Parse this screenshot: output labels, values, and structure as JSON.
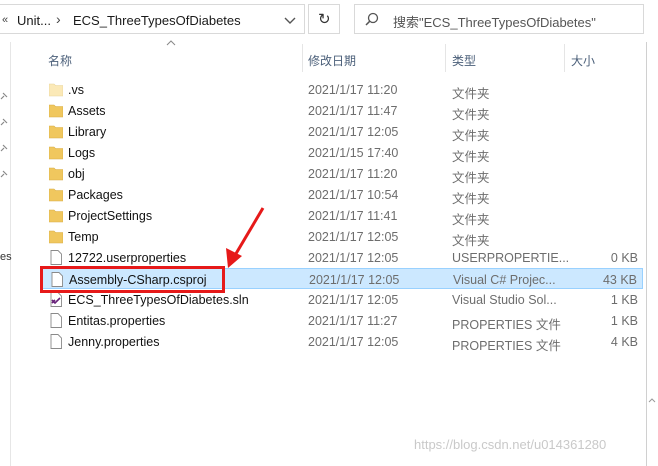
{
  "address": {
    "back_glyph": "«",
    "crumb_parent": "Unit...",
    "crumb_sep": "›",
    "crumb_current": "ECS_ThreeTypesOfDiabetes",
    "search_placeholder": "搜索\"ECS_ThreeTypesOfDiabetes\""
  },
  "nav": {
    "cut_text": "es"
  },
  "columns": {
    "name": "名称",
    "date": "修改日期",
    "type": "类型",
    "size": "大小"
  },
  "rows": [
    {
      "name": ".vs",
      "date": "2021/1/17 11:20",
      "type": "文件夹",
      "size": "",
      "icon": "folder-light-icon"
    },
    {
      "name": "Assets",
      "date": "2021/1/17 11:47",
      "type": "文件夹",
      "size": "",
      "icon": "folder-icon"
    },
    {
      "name": "Library",
      "date": "2021/1/17 12:05",
      "type": "文件夹",
      "size": "",
      "icon": "folder-icon"
    },
    {
      "name": "Logs",
      "date": "2021/1/15 17:40",
      "type": "文件夹",
      "size": "",
      "icon": "folder-icon"
    },
    {
      "name": "obj",
      "date": "2021/1/17 11:20",
      "type": "文件夹",
      "size": "",
      "icon": "folder-icon"
    },
    {
      "name": "Packages",
      "date": "2021/1/17 10:54",
      "type": "文件夹",
      "size": "",
      "icon": "folder-icon"
    },
    {
      "name": "ProjectSettings",
      "date": "2021/1/17 11:41",
      "type": "文件夹",
      "size": "",
      "icon": "folder-icon"
    },
    {
      "name": "Temp",
      "date": "2021/1/17 12:05",
      "type": "文件夹",
      "size": "",
      "icon": "folder-icon"
    },
    {
      "name": "12722.userproperties",
      "date": "2021/1/17 12:05",
      "type": "USERPROPERTIE...",
      "size": "0 KB",
      "icon": "file-icon"
    },
    {
      "name": "Assembly-CSharp.csproj",
      "date": "2021/1/17 12:05",
      "type": "Visual C# Projec...",
      "size": "43 KB",
      "icon": "file-icon",
      "selected": true
    },
    {
      "name": "ECS_ThreeTypesOfDiabetes.sln",
      "date": "2021/1/17 12:05",
      "type": "Visual Studio Sol...",
      "size": "1 KB",
      "icon": "vs-solution-icon"
    },
    {
      "name": "Entitas.properties",
      "date": "2021/1/17 11:27",
      "type": "PROPERTIES 文件",
      "size": "1 KB",
      "icon": "file-icon"
    },
    {
      "name": "Jenny.properties",
      "date": "2021/1/17 12:05",
      "type": "PROPERTIES 文件",
      "size": "4 KB",
      "icon": "file-icon"
    }
  ],
  "watermark": "https://blog.csdn.net/u014361280",
  "colors": {
    "selection": "#cce8ff",
    "folder": "#f0c75e",
    "annotation": "#e61919"
  }
}
